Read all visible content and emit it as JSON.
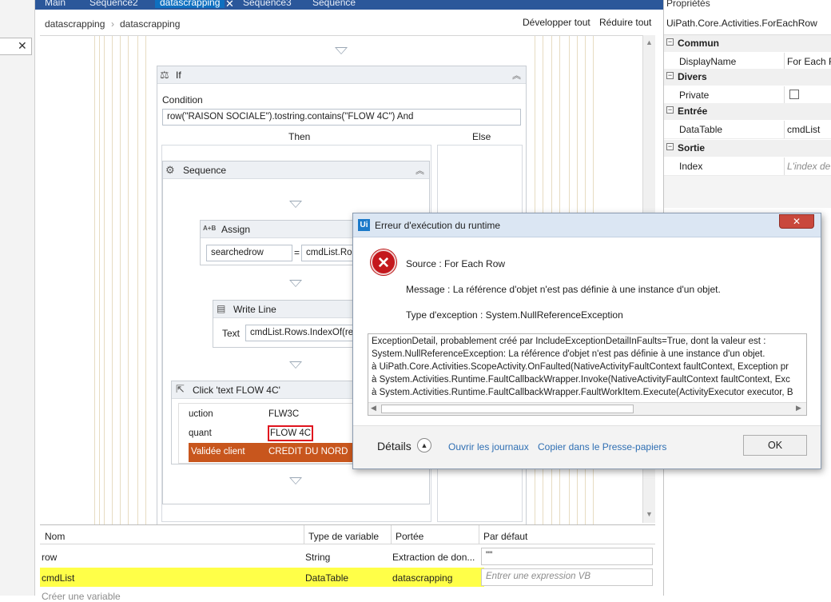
{
  "tabs": [
    {
      "label": "Main"
    },
    {
      "label": "Séquence2"
    },
    {
      "label": "datascrapping"
    },
    {
      "label": "Séquence3"
    },
    {
      "label": "Séquence"
    }
  ],
  "breadcrumb": [
    "datascrapping",
    "datascrapping"
  ],
  "expand_all": "Développer tout",
  "collapse_all": "Réduire tout",
  "if_activity": {
    "title": "If",
    "condition_label": "Condition",
    "condition": "row(\"RAISON SOCIALE\").tostring.contains(\"FLOW 4C\") And",
    "then": "Then",
    "else": "Else"
  },
  "sequence": {
    "title": "Sequence"
  },
  "assign": {
    "title": "Assign",
    "icon": "A+B",
    "to": "searchedrow",
    "eq": "=",
    "value": "cmdList.Ro"
  },
  "writeline": {
    "title": "Write Line",
    "text_label": "Text",
    "text": "cmdList.Rows.IndexOf(re"
  },
  "click": {
    "title": "Click 'text  FLOW 4C'",
    "rows": [
      [
        "uction",
        "FLW3C"
      ],
      [
        "quant",
        "FLOW 4C"
      ],
      [
        "Validée client",
        "CREDIT DU NORD"
      ]
    ]
  },
  "variables": {
    "headers": [
      "Nom",
      "Type de variable",
      "Portée",
      "Par défaut"
    ],
    "rows": [
      [
        "row",
        "String",
        "Extraction de don...",
        "\"\""
      ],
      [
        "cmdList",
        "DataTable",
        "datascrapping",
        "Entrer une expression VB"
      ]
    ],
    "create": "Créer une variable"
  },
  "properties": {
    "title": "Propriétés",
    "type": "UiPath.Core.Activities.ForEachRow",
    "categories": [
      {
        "name": "Commun",
        "props": [
          {
            "name": "DisplayName",
            "value": "For Each Ro"
          }
        ]
      },
      {
        "name": "Divers",
        "props": [
          {
            "name": "Private",
            "value": ""
          }
        ]
      },
      {
        "name": "Entrée",
        "props": [
          {
            "name": "DataTable",
            "value": "cmdList"
          }
        ]
      },
      {
        "name": "Sortie",
        "props": [
          {
            "name": "Index",
            "value": "L'index de"
          }
        ]
      }
    ]
  },
  "dialog": {
    "logo": "Ui",
    "title": "Erreur d'exécution du runtime",
    "source": "Source : For Each Row",
    "message": "Message : La référence d'objet n'est pas définie à une instance d'un objet.",
    "exception": "Type d'exception : System.NullReferenceException",
    "details": [
      "ExceptionDetail, probablement créé par IncludeExceptionDetailInFaults=True, dont la valeur est :",
      "System.NullReferenceException: La référence d'objet n'est pas définie à une instance d'un objet.",
      "   à UiPath.Core.Activities.ScopeActivity.OnFaulted(NativeActivityFaultContext faultContext, Exception pr",
      "   à System.Activities.Runtime.FaultCallbackWrapper.Invoke(NativeActivityFaultContext faultContext, Exc",
      "   à System.Activities.Runtime.FaultCallbackWrapper.FaultWorkItem.Execute(ActivityExecutor executor, B"
    ],
    "details_toggle": "Détails",
    "open_logs": "Ouvrir les journaux",
    "copy": "Copier dans le Presse-papiers",
    "ok": "OK"
  }
}
